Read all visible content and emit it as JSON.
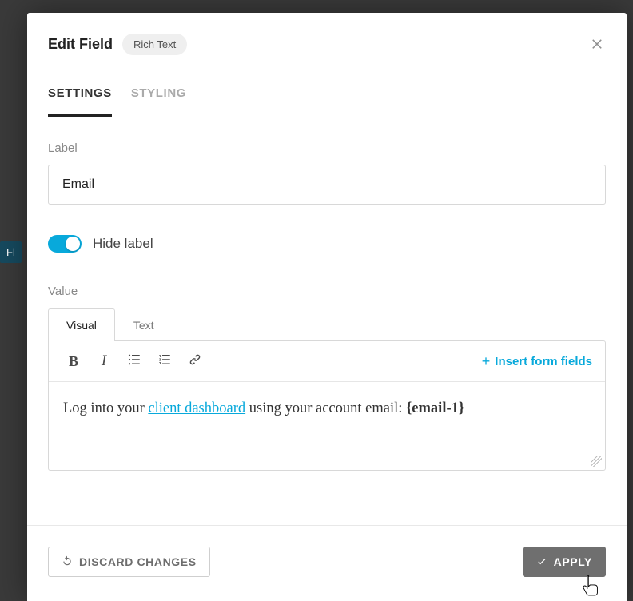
{
  "header": {
    "title": "Edit Field",
    "chip": "Rich Text"
  },
  "tabs": {
    "settings": "SETTINGS",
    "styling": "STYLING"
  },
  "form": {
    "label_caption": "Label",
    "label_value": "Email",
    "hide_label": "Hide label",
    "value_caption": "Value",
    "subtabs": {
      "visual": "Visual",
      "text": "Text"
    },
    "insert_fields": "Insert form fields",
    "content": {
      "prefix": "Log into your ",
      "link_text": "client dashboard",
      "middle": " using your account email: ",
      "merge_tag": "{email-1}"
    }
  },
  "footer": {
    "discard": "DISCARD CHANGES",
    "apply": "APPLY"
  }
}
